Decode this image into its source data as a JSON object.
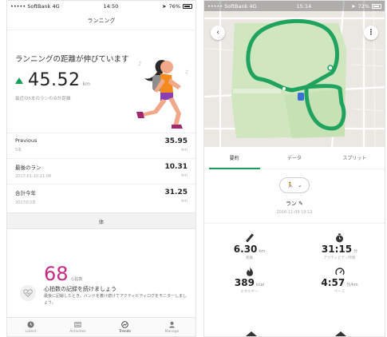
{
  "left": {
    "status": {
      "carrier": "••••• SoftBank 4G",
      "time": "14:50",
      "battery": "76%"
    },
    "header_title": "ランニング",
    "hero": {
      "title": "ランニングの距離が伸びています",
      "value": "45.52",
      "unit": "km",
      "subtitle": "最近の5本のランの合計距離"
    },
    "stats": [
      {
        "label": "Previous",
        "sub": "5本",
        "value": "35.95",
        "unit": "km"
      },
      {
        "label": "最後のラン",
        "sub": "2017-01-10 21:08",
        "value": "10.31",
        "unit": "km"
      },
      {
        "label": "合計今年",
        "sub": "2017の3本",
        "value": "31.25",
        "unit": "km"
      }
    ],
    "section_label": "体",
    "heart": {
      "value": "68",
      "unit": "心拍数",
      "title": "心拍数の記録を続けましょう",
      "desc": "最後に記録したとき。バンドを着け続けてアクティビティログをモニターしましょう。"
    },
    "tabs": [
      {
        "label": "Latest",
        "icon": "clock-icon"
      },
      {
        "label": "Activities",
        "icon": "list-icon"
      },
      {
        "label": "Trends",
        "icon": "trends-icon",
        "active": true
      },
      {
        "label": "Manage",
        "icon": "person-icon"
      }
    ],
    "colors": {
      "accent_green": "#1a9f5a",
      "heart_pink": "#c6287f"
    }
  },
  "right": {
    "status": {
      "carrier": "••••• SoftBank 4G",
      "time": "15:14",
      "battery": "72%"
    },
    "tabs": [
      {
        "label": "要約",
        "active": true
      },
      {
        "label": "データ"
      },
      {
        "label": "スプリット"
      }
    ],
    "activity": {
      "title": "ラン",
      "date": "2016-11-09 19:12"
    },
    "metrics": [
      {
        "icon": "ruler-icon",
        "value": "6.30",
        "unit": "km",
        "label": "距離"
      },
      {
        "icon": "stopwatch-icon",
        "value": "31:15",
        "unit": "分",
        "label": "アクティビティ時間"
      },
      {
        "icon": "flame-icon",
        "value": "389",
        "unit": "kcal",
        "label": "エネルギー"
      },
      {
        "icon": "pace-icon",
        "value": "4:57",
        "unit": "分/km",
        "label": "ペース"
      }
    ],
    "colors": {
      "route_green": "#1fa35f",
      "park_green": "#cfe6bf"
    }
  }
}
